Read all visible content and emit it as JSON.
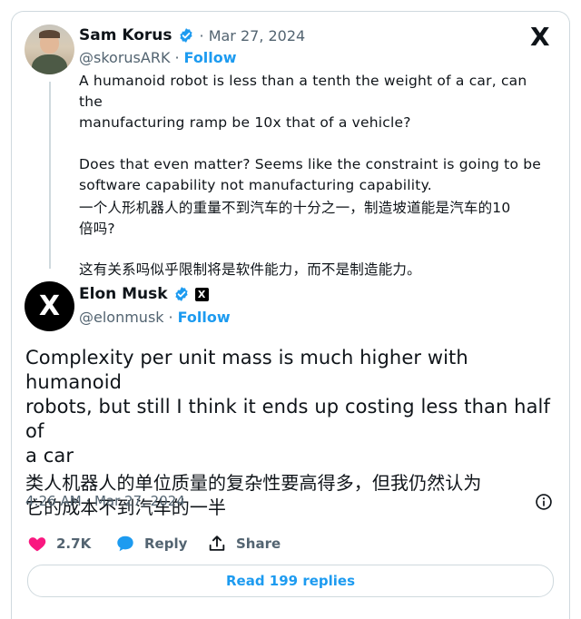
{
  "quoted": {
    "name": "Sam Korus",
    "date": "· Mar 27, 2024",
    "handle": "@skorusARK",
    "separator": "·",
    "follow_label": "Follow",
    "lines": [
      "A humanoid robot is less than a tenth the weight of a car, can the",
      "manufacturing ramp be 10x that of a vehicle?",
      "Does that even matter? Seems like the constraint is going to be",
      "software capability not manufacturing capability.",
      "一个人形机器人的重量不到汽车的十分之一，制造坡道能是汽车的10",
      "倍吗?",
      "这有关系吗似乎限制将是软件能力，而不是制造能力。"
    ]
  },
  "main": {
    "name": "Elon Musk",
    "handle": "@elonmusk",
    "separator": "·",
    "follow_label": "Follow",
    "badge": "X",
    "avatar_letter": "X",
    "lines": [
      "Complexity per unit mass is much higher with humanoid",
      "robots, but still I think it ends up costing less than half of",
      "a car",
      "类人机器人的单位质量的复杂性要高得多，但我仍然认为",
      "它的成本不到汽车的一半"
    ],
    "timestamp": "4:26 AM · Mar 27, 2024"
  },
  "actions": {
    "likes": "2.7K",
    "reply_label": "Reply",
    "share_label": "Share"
  },
  "read_replies": "Read 199 replies",
  "brand_logo": "X",
  "colors": {
    "accent": "#1d9bf0",
    "like": "#f91880",
    "text": "#0f1419",
    "muted": "#536471"
  },
  "icons": [
    "verified-badge-icon",
    "x-logo-icon",
    "heart-icon",
    "speech-bubble-icon",
    "share-icon",
    "info-icon"
  ]
}
